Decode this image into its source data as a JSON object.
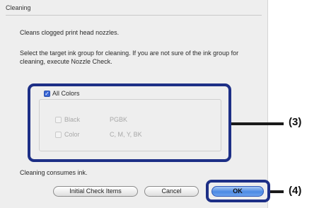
{
  "dialog": {
    "title": "Cleaning",
    "description": "Cleans clogged print head nozzles.",
    "instruction": "Select the target ink group for cleaning. If you are not sure of the ink group for cleaning, execute Nozzle Check.",
    "ink_groups": {
      "all_colors": {
        "label": "All Colors",
        "checked": true
      },
      "black": {
        "label": "Black",
        "ink": "PGBK",
        "checked": false,
        "enabled": false
      },
      "color": {
        "label": "Color",
        "ink": "C, M, Y, BK",
        "checked": false,
        "enabled": false
      }
    },
    "consumes_note": "Cleaning consumes ink.",
    "buttons": {
      "initial_check": "Initial Check Items",
      "cancel": "Cancel",
      "ok": "OK"
    }
  },
  "callouts": {
    "group_label": "(3)",
    "ok_label": "(4)"
  },
  "colors": {
    "callout_frame": "#1d2f86",
    "default_button": "#4d8ae3"
  },
  "icons": {
    "checkbox_checked": "checkmark-icon"
  }
}
